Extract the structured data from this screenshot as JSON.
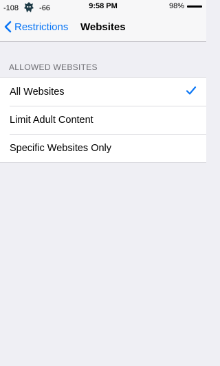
{
  "status_bar": {
    "signal_left": "-108",
    "signal_right": "-66",
    "time": "9:58 PM",
    "battery": "98%",
    "app_icon": "ghost-icon"
  },
  "nav": {
    "back_label": "Restrictions",
    "title": "Websites"
  },
  "section": {
    "header": "ALLOWED WEBSITES"
  },
  "options": [
    {
      "label": "All Websites",
      "selected": true
    },
    {
      "label": "Limit Adult Content",
      "selected": false
    },
    {
      "label": "Specific Websites Only",
      "selected": false
    }
  ],
  "colors": {
    "accent": "#0a76f5",
    "background": "#efeff4",
    "secondary_text": "#6d6d72"
  }
}
